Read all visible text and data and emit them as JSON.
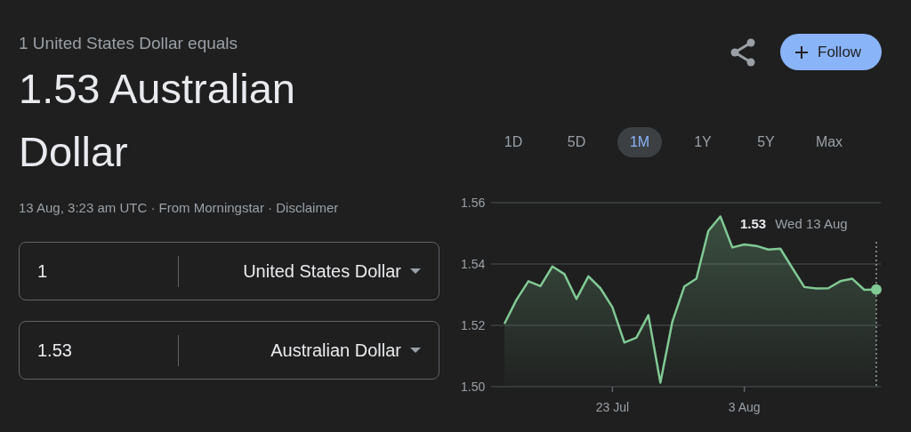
{
  "header": {
    "subtitle": "1 United States Dollar equals",
    "result": "1.53 Australian Dollar",
    "meta": "13 Aug, 3:23 am UTC · From Morningstar · Disclaimer"
  },
  "converter": [
    {
      "amount": "1",
      "currency": "United States Dollar"
    },
    {
      "amount": "1.53",
      "currency": "Australian Dollar"
    }
  ],
  "actions": {
    "follow": "Follow"
  },
  "ranges": [
    {
      "label": "1D",
      "selected": false
    },
    {
      "label": "5D",
      "selected": false
    },
    {
      "label": "1M",
      "selected": true
    },
    {
      "label": "1Y",
      "selected": false
    },
    {
      "label": "5Y",
      "selected": false
    },
    {
      "label": "Max",
      "selected": false
    }
  ],
  "chart": {
    "tooltip": {
      "value": "1.53",
      "date": "Wed 13 Aug"
    },
    "chart_data": {
      "type": "area",
      "categories": [
        null,
        null,
        null,
        null,
        null,
        null,
        null,
        null,
        null,
        "23 Jul",
        null,
        null,
        null,
        null,
        null,
        null,
        null,
        null,
        null,
        null,
        "3 Aug",
        null,
        null,
        null,
        null,
        null,
        null,
        null,
        null,
        null,
        null,
        null
      ],
      "series": [
        {
          "color": "#81c995",
          "values": [
            1.5205,
            1.5283,
            1.5344,
            1.5328,
            1.5392,
            1.5367,
            1.5286,
            1.536,
            1.5321,
            1.5259,
            1.5144,
            1.516,
            1.5233,
            1.5013,
            1.5212,
            1.5327,
            1.5352,
            1.5508,
            1.5555,
            1.5454,
            1.5464,
            1.5459,
            1.5447,
            1.545,
            1.5387,
            1.5325,
            1.532,
            1.5321,
            1.5344,
            1.5352,
            1.5316,
            1.5317
          ]
        }
      ],
      "ylim": [
        1.5,
        1.56
      ],
      "yticks": [
        {
          "value": 1.5,
          "label": "1.50"
        },
        {
          "value": 1.52,
          "label": "1.52"
        },
        {
          "value": 1.54,
          "label": "1.54"
        },
        {
          "value": 1.56,
          "label": "1.56"
        }
      ]
    }
  }
}
